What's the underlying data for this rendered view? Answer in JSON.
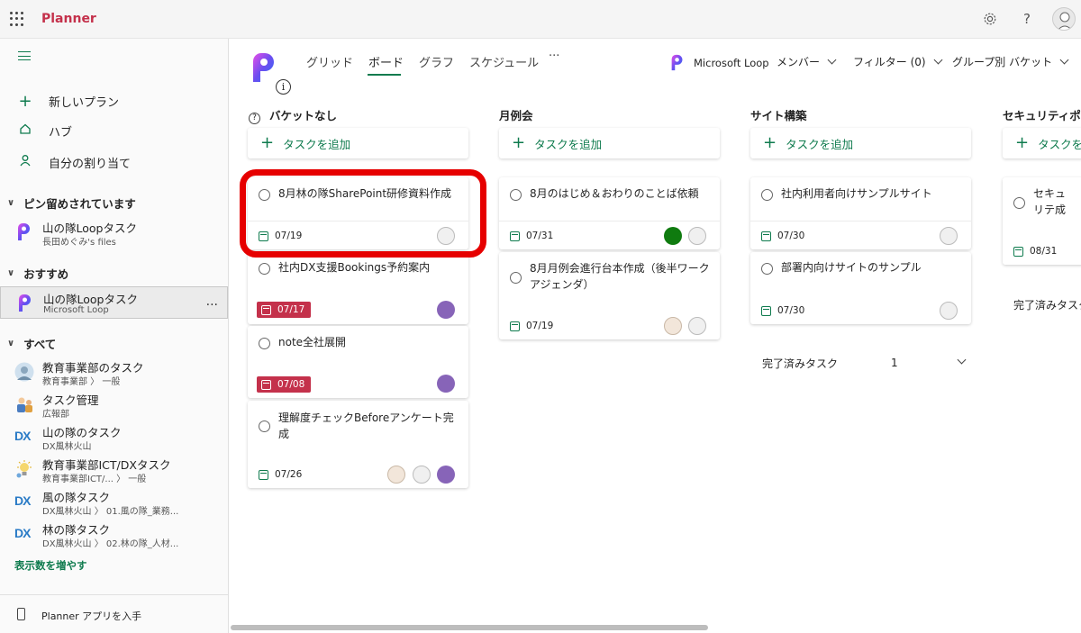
{
  "app": {
    "name": "Planner"
  },
  "sidebar": {
    "nav": [
      {
        "label": "新しいプラン",
        "icon": "plus-icon"
      },
      {
        "label": "ハブ",
        "icon": "home-icon"
      },
      {
        "label": "自分の割り当て",
        "icon": "person-icon"
      }
    ],
    "sections": {
      "pinned": "ピン留めされています",
      "recommended": "おすすめ",
      "all": "すべて"
    },
    "pinned_items": [
      {
        "name": "山の隊Loopタスク",
        "sub": "長田めぐみ's files",
        "icon": "loop-icon"
      }
    ],
    "recommended_items": [
      {
        "name": "山の隊Loopタスク",
        "sub": "Microsoft Loop",
        "icon": "loop-icon",
        "more": "..."
      }
    ],
    "all_items": [
      {
        "name": "教育事業部のタスク",
        "sub": "教育事業部 〉 一般",
        "icon": "photo-icon"
      },
      {
        "name": "タスク管理",
        "sub": "広報部",
        "icon": "illustration-icon"
      },
      {
        "name": "山の隊のタスク",
        "sub": "DX風林火山",
        "icon": "dx-icon",
        "icon_text": "DX"
      },
      {
        "name": "教育事業部ICT/DXタスク",
        "sub": "教育事業部ICT/... 〉 一般",
        "icon": "lightbulb-icon"
      },
      {
        "name": "風の隊タスク",
        "sub": "DX風林火山 〉 01.風の隊_業務...",
        "icon": "dx-icon",
        "icon_text": "DX"
      },
      {
        "name": "林の隊タスク",
        "sub": "DX風林火山 〉 02.林の隊_人材...",
        "icon": "dx-icon",
        "icon_text": "DX"
      }
    ],
    "show_more": "表示数を増やす",
    "footer": "Planner アプリを入手"
  },
  "header": {
    "tabs": [
      "グリッド",
      "ボード",
      "グラフ",
      "スケジュール",
      "···"
    ],
    "active_tab": "ボード",
    "loop_label": "Microsoft Loop",
    "members": "メンバー",
    "filter": "フィルター (0)",
    "group_by": "グループ別 バケット"
  },
  "buckets": [
    {
      "name": "バケットなし",
      "add_label": "タスクを追加",
      "tasks": [
        {
          "title": "8月林の隊SharePoint研修資料作成",
          "due": "07/19",
          "overdue": false,
          "assignees": [
            "outline"
          ]
        },
        {
          "title": "社内DX支援Bookings予約案内",
          "due": "07/17",
          "overdue": true,
          "assignees": [
            "purple"
          ]
        },
        {
          "title": "note全社展開",
          "due": "07/08",
          "overdue": true,
          "assignees": [
            "purple"
          ]
        },
        {
          "title": "理解度チェックBeforeアンケート完成",
          "due": "07/26",
          "overdue": false,
          "assignees": [
            "photo",
            "outline",
            "purple"
          ]
        }
      ]
    },
    {
      "name": "月例会",
      "add_label": "タスクを追加",
      "tasks": [
        {
          "title": "8月のはじめ＆おわりのことば依頼",
          "due": "07/31",
          "overdue": false,
          "assignees": [
            "green",
            "outline"
          ]
        },
        {
          "title": "8月月例会進行台本作成（後半ワークアジェンダ）",
          "due": "07/19",
          "overdue": false,
          "assignees": [
            "photo",
            "outline"
          ]
        }
      ]
    },
    {
      "name": "サイト構築",
      "add_label": "タスクを追加",
      "tasks": [
        {
          "title": "社内利用者向けサンプルサイト",
          "due": "07/30",
          "overdue": false,
          "assignees": [
            "outline"
          ]
        },
        {
          "title": "部署内向けサイトのサンプル",
          "due": "07/30",
          "overdue": false,
          "assignees": [
            "outline"
          ]
        }
      ],
      "completed_label": "完了済みタスク",
      "completed_count": "1"
    },
    {
      "name": "セキュリティポリ",
      "add_label": "タスクを",
      "tasks": [
        {
          "title": "セキュリテ成",
          "due": "08/31",
          "overdue": false,
          "assignees": []
        }
      ],
      "completed_label": "完了済みタスク"
    }
  ],
  "colors": {
    "accent": "#0f7b4e",
    "brand": "#c4314b",
    "overdue": "#c4314b",
    "highlight": "#e60000"
  }
}
